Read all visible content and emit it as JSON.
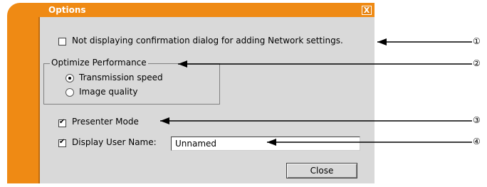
{
  "window": {
    "title": "Options",
    "close_glyph": "X"
  },
  "options": {
    "no_confirm_label": "Not displaying confirmation dialog for adding Network settings.",
    "no_confirm_checked": false,
    "optimize_group_label": "Optimize Performance",
    "radio_transmission_label": "Transmission speed",
    "radio_image_label": "Image quality",
    "selected_radio": "transmission",
    "presenter_label": "Presenter Mode",
    "presenter_checked": true,
    "display_user_label": "Display User Name:",
    "display_user_checked": true,
    "user_name_value": "Unnamed",
    "close_label": "Close"
  },
  "callouts": [
    "①",
    "②",
    "③",
    "④"
  ],
  "colors": {
    "accent": "#ef8a14",
    "panel": "#d9d9d9"
  }
}
